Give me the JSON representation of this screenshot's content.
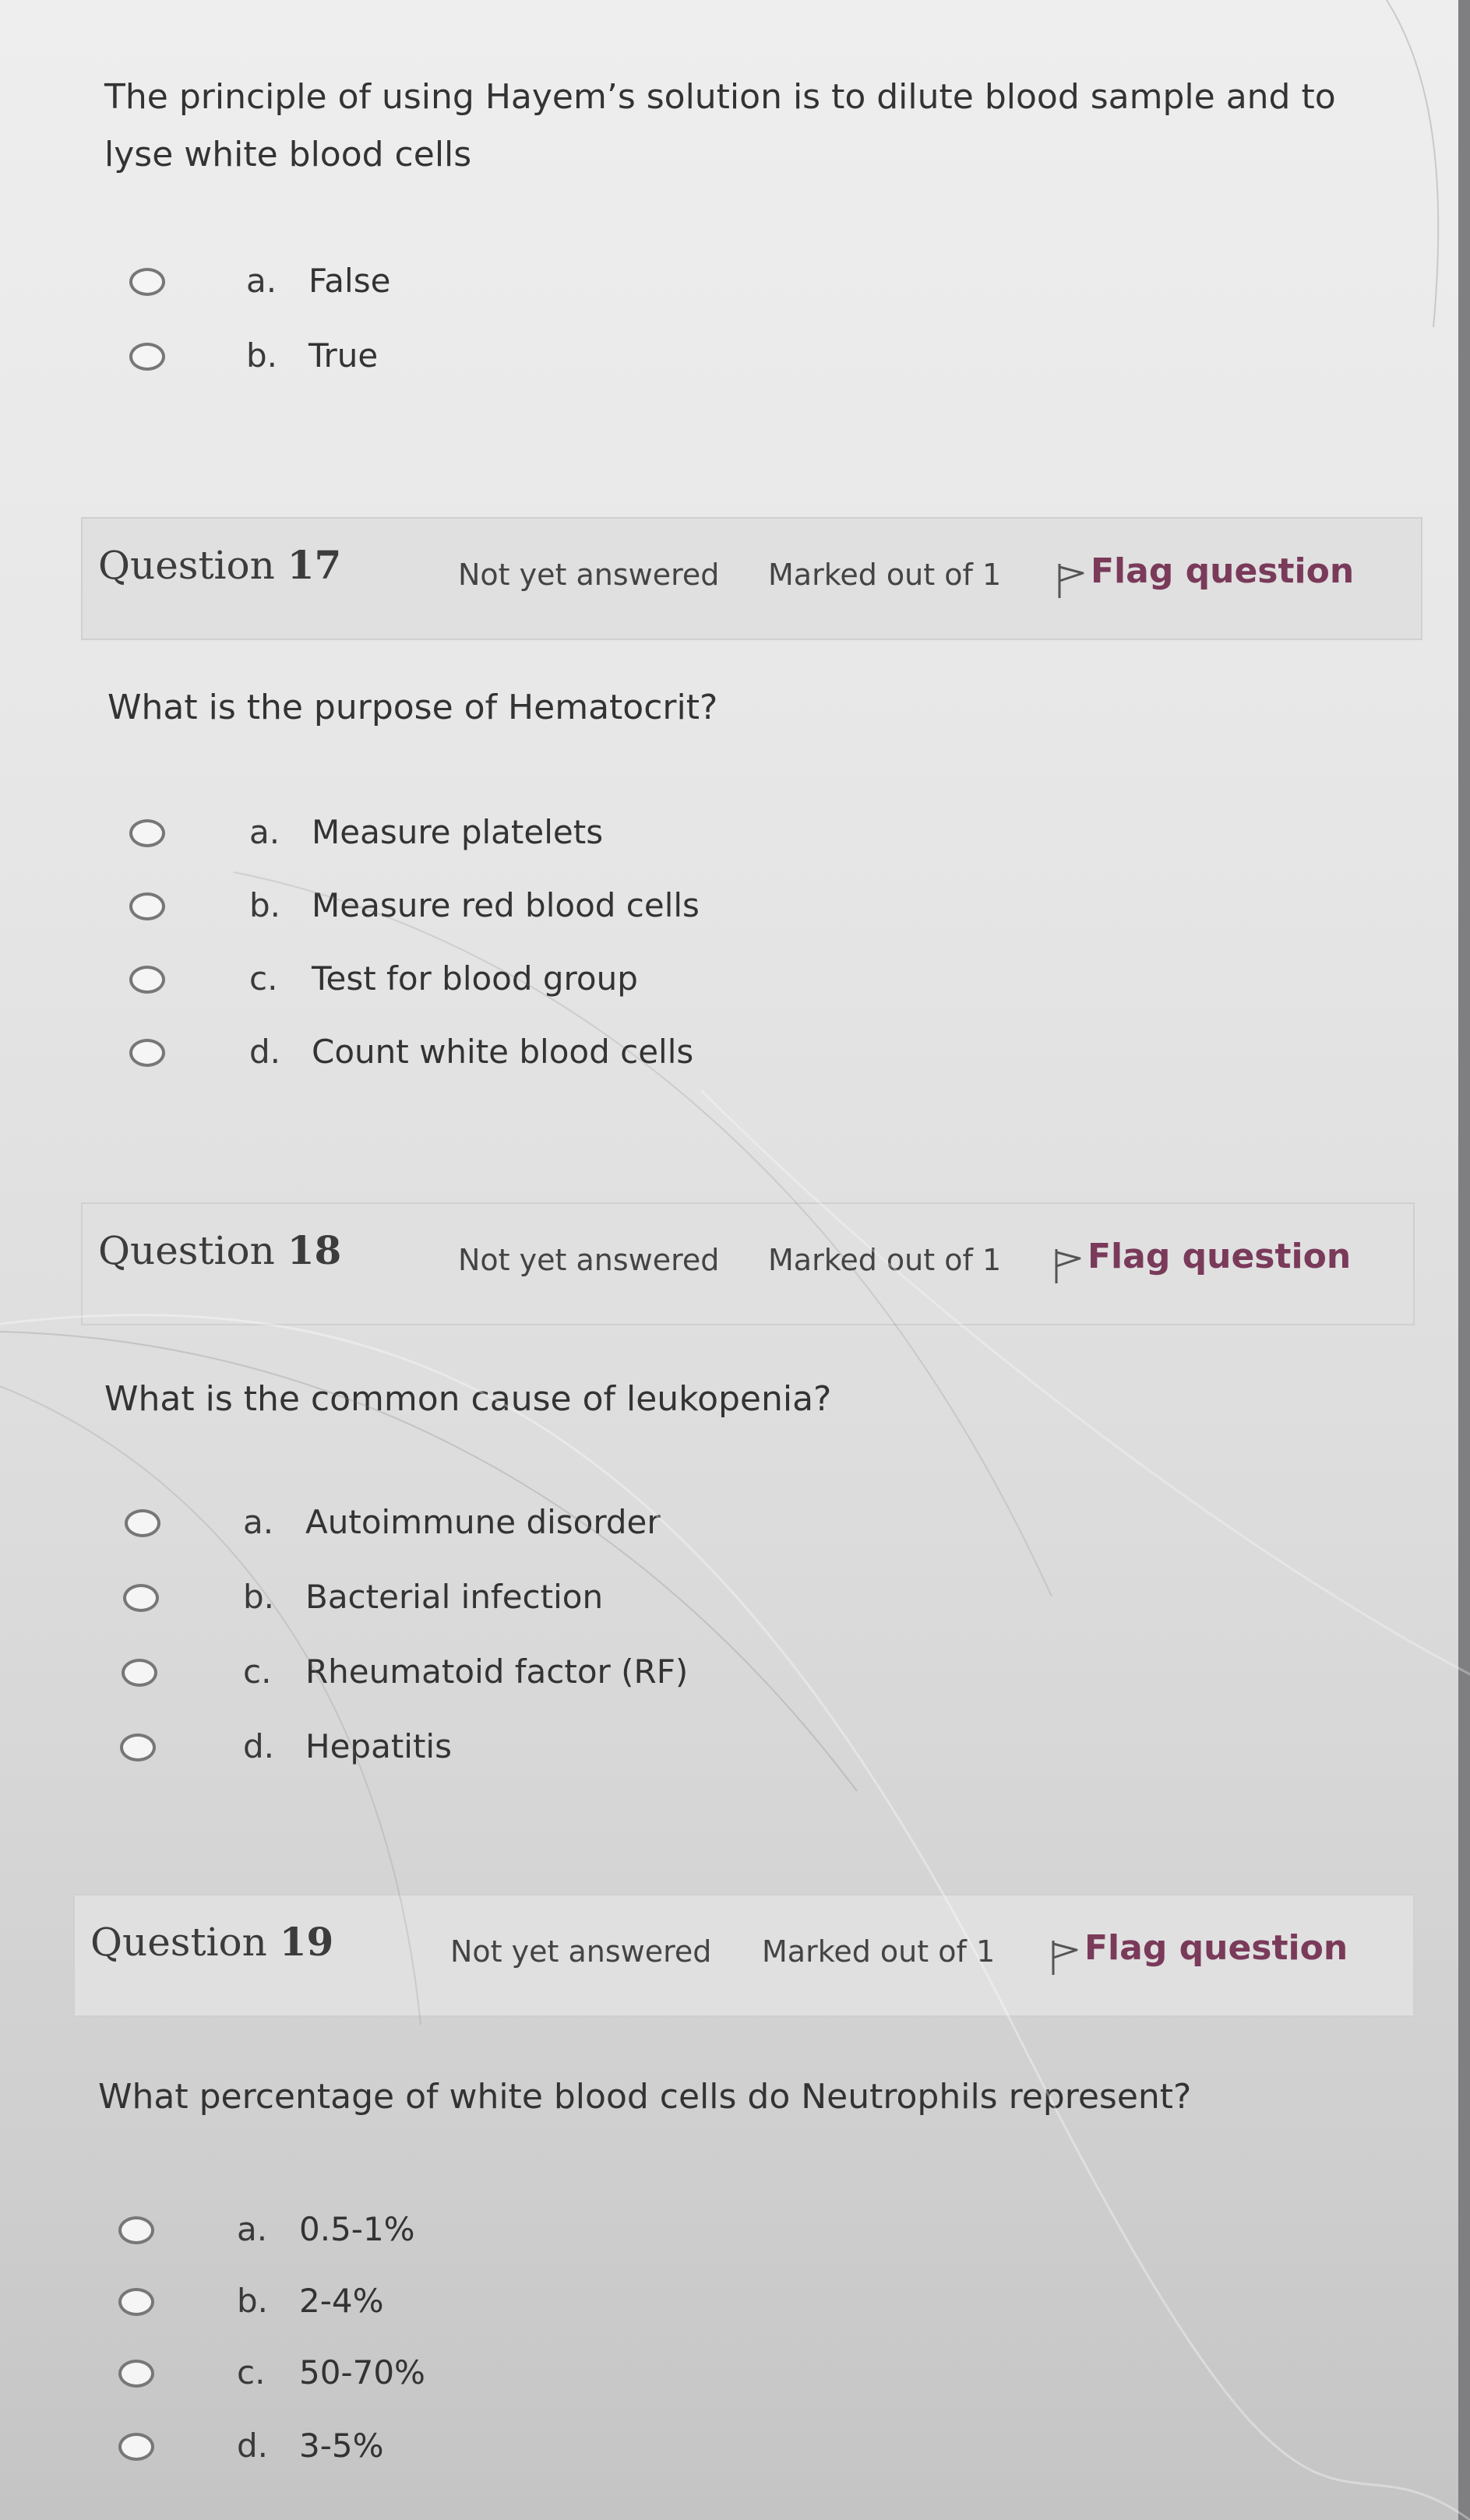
{
  "q16": {
    "prompt": "The principle of using Hayem’s solution is to dilute blood sample and to lyse white blood cells",
    "options": [
      {
        "letter": "a.",
        "text": "False"
      },
      {
        "letter": "b.",
        "text": "True"
      }
    ]
  },
  "q17": {
    "title_word": "Question",
    "number": "17",
    "status": "Not yet answered",
    "marks": "Marked out of 1",
    "flag_label": "Flag question",
    "prompt": "What is the purpose of Hematocrit?",
    "options": [
      {
        "letter": "a.",
        "text": "Measure platelets"
      },
      {
        "letter": "b.",
        "text": "Measure red blood cells"
      },
      {
        "letter": "c.",
        "text": "Test for blood group"
      },
      {
        "letter": "d.",
        "text": "Count white blood cells"
      }
    ]
  },
  "q18": {
    "title_word": "Question",
    "number": "18",
    "status": "Not yet answered",
    "marks": "Marked out of 1",
    "flag_label": "Flag question",
    "prompt": "What is the common cause of leukopenia?",
    "options": [
      {
        "letter": "a.",
        "text": "Autoimmune disorder"
      },
      {
        "letter": "b.",
        "text": "Bacterial infection"
      },
      {
        "letter": "c.",
        "text": "Rheumatoid factor (RF)"
      },
      {
        "letter": "d.",
        "text": "Hepatitis"
      }
    ]
  },
  "q19": {
    "title_word": "Question",
    "number": "19",
    "status": "Not yet answered",
    "marks": "Marked out of 1",
    "flag_label": "Flag question",
    "prompt": "What percentage of white blood cells do Neutrophils represent?",
    "options": [
      {
        "letter": "a.",
        "text": "0.5-1%"
      },
      {
        "letter": "b.",
        "text": "2-4%"
      },
      {
        "letter": "c.",
        "text": "50-70%"
      },
      {
        "letter": "d.",
        "text": "3-5%"
      }
    ]
  },
  "colors": {
    "flag_accent": "#7a3a5a",
    "header_bg": "#e0e0e0",
    "page_bg": "#e8e8e8"
  },
  "icons": {
    "flag": "flag-outline-icon",
    "radio": "radio-empty-icon"
  }
}
